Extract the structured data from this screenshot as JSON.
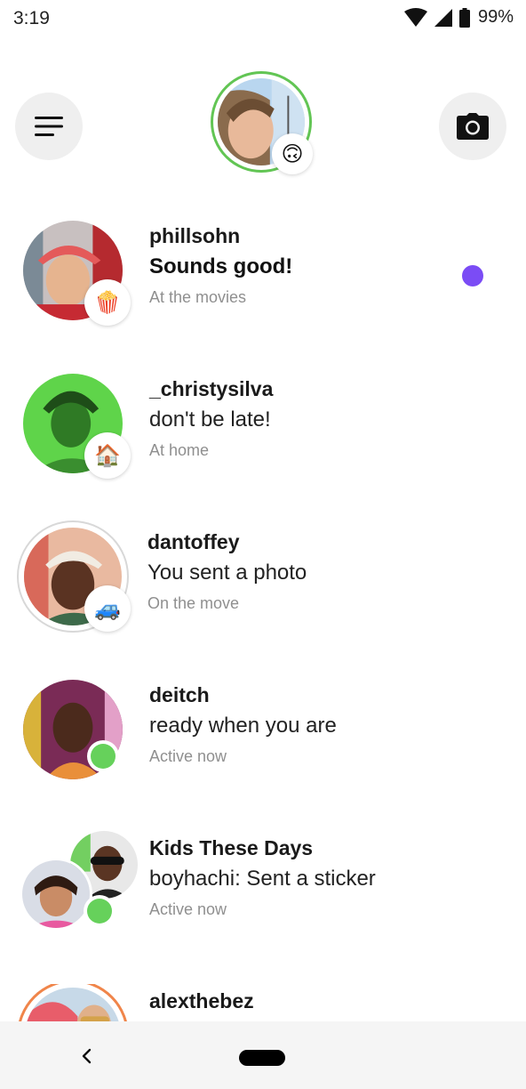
{
  "status_bar": {
    "time": "3:19",
    "battery": "99%",
    "icons": [
      "wifi-icon",
      "cellular-signal-icon",
      "battery-icon"
    ]
  },
  "header": {
    "menu_icon": "menu-icon",
    "camera_icon": "camera-icon",
    "profile_status_emoji": "🙃"
  },
  "conversations": [
    {
      "name": "phillsohn",
      "message": "Sounds good!",
      "status": "At the movies",
      "status_emoji": "🍿",
      "unread": true
    },
    {
      "name": "_christysilva",
      "message": "don't be late!",
      "status": "At home",
      "status_emoji": "🏠",
      "unread": false
    },
    {
      "name": "dantoffey",
      "message": "You sent a photo",
      "status": "On the move",
      "status_emoji": "🚙",
      "unread": false
    },
    {
      "name": "deitch",
      "message": "ready when you are",
      "status": "Active now",
      "unread": false
    },
    {
      "name": "Kids These Days",
      "message": "boyhachi: Sent a sticker",
      "status": "Active now",
      "unread": false
    },
    {
      "name": "alexthebez"
    }
  ],
  "colors": {
    "story_ring": "#62c554",
    "active_green": "#66d15b",
    "unread_dot": "#7b4cf5",
    "nav_bar": "#f5f5f5"
  },
  "nav": {
    "back_icon": "back-chevron-icon",
    "home_icon": "home-pill-icon"
  }
}
